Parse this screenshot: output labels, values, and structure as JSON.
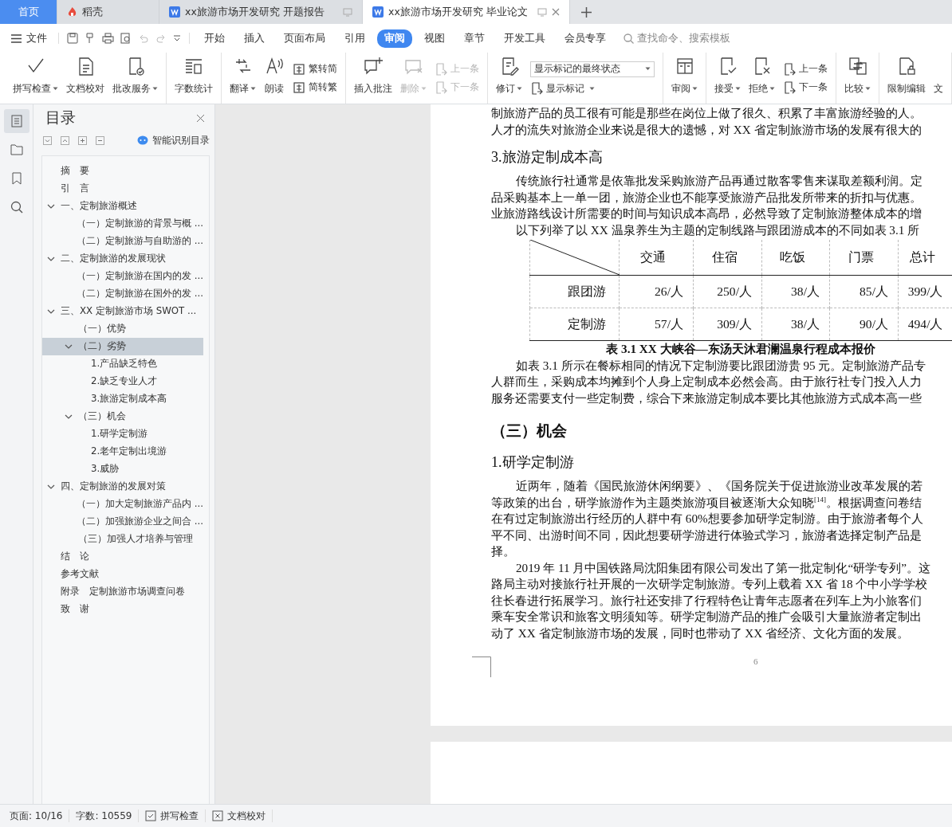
{
  "tabs": [
    {
      "label": "首页",
      "kind": "home",
      "selected": false
    },
    {
      "label": "稻壳",
      "kind": "app",
      "selected": false
    },
    {
      "label": "xx旅游市场开发研究 开题报告",
      "kind": "doc",
      "selected": false
    },
    {
      "label": "xx旅游市场开发研究 毕业论文",
      "kind": "doc",
      "selected": true
    }
  ],
  "menu": {
    "file": "文件",
    "tabs": [
      {
        "label": "开始",
        "selected": false
      },
      {
        "label": "插入",
        "selected": false
      },
      {
        "label": "页面布局",
        "selected": false
      },
      {
        "label": "引用",
        "selected": false
      },
      {
        "label": "审阅",
        "selected": true
      },
      {
        "label": "视图",
        "selected": false
      },
      {
        "label": "章节",
        "selected": false
      },
      {
        "label": "开发工具",
        "selected": false
      },
      {
        "label": "会员专享",
        "selected": false
      }
    ],
    "search": {
      "placeholder": "查找命令、搜索模板"
    }
  },
  "ribbon_groups": [
    {
      "tools": [
        {
          "kind": "large",
          "label": "拼写检查",
          "dropdown": true,
          "disabled": false
        },
        {
          "kind": "large",
          "label": "文档校对",
          "dropdown": false,
          "disabled": false
        },
        {
          "kind": "large",
          "label": "批改服务",
          "dropdown": true,
          "disabled": false
        }
      ]
    },
    {
      "tools": [
        {
          "kind": "large",
          "label": "字数统计",
          "dropdown": false,
          "disabled": false
        }
      ]
    },
    {
      "tools": [
        {
          "kind": "large",
          "label": "翻译",
          "dropdown": true,
          "disabled": false
        },
        {
          "kind": "large",
          "label": "朗读",
          "dropdown": false,
          "disabled": false
        },
        {
          "kind": "stack",
          "items": [
            {
              "label": "繁转简",
              "dropdown": false,
              "disabled": false
            },
            {
              "label": "简转繁",
              "dropdown": false,
              "disabled": false
            }
          ]
        }
      ]
    },
    {
      "tools": [
        {
          "kind": "large",
          "label": "插入批注",
          "dropdown": false,
          "disabled": false
        },
        {
          "kind": "large",
          "label": "删除",
          "dropdown": true,
          "disabled": true
        },
        {
          "kind": "stack",
          "items": [
            {
              "label": "上一条",
              "dropdown": false,
              "disabled": true
            },
            {
              "label": "下一条",
              "dropdown": false,
              "disabled": true
            }
          ]
        }
      ]
    },
    {
      "tools": [
        {
          "kind": "large",
          "label": "修订",
          "dropdown": true,
          "disabled": false
        },
        {
          "kind": "combo",
          "value": "显示标记的最终状态",
          "items": [
            {
              "label": "显示标记",
              "dropdown": true,
              "disabled": false
            }
          ]
        }
      ]
    },
    {
      "tools": [
        {
          "kind": "large",
          "label": "审阅",
          "dropdown": true,
          "disabled": false
        }
      ]
    },
    {
      "tools": [
        {
          "kind": "large",
          "label": "接受",
          "dropdown": true,
          "disabled": false
        },
        {
          "kind": "large",
          "label": "拒绝",
          "dropdown": true,
          "disabled": false
        },
        {
          "kind": "stack",
          "items": [
            {
              "label": "上一条",
              "dropdown": false,
              "disabled": false
            },
            {
              "label": "下一条",
              "dropdown": false,
              "disabled": false
            }
          ]
        }
      ]
    },
    {
      "tools": [
        {
          "kind": "large",
          "label": "比较",
          "dropdown": true,
          "disabled": false
        }
      ]
    },
    {
      "tools": [
        {
          "kind": "large",
          "label": "限制编辑",
          "dropdown": false,
          "disabled": false
        },
        {
          "kind": "large",
          "label": "文",
          "dropdown": false,
          "disabled": false
        }
      ]
    }
  ],
  "rail": [
    {
      "selected": true
    },
    {
      "selected": false
    },
    {
      "selected": false
    },
    {
      "selected": false
    }
  ],
  "nav": {
    "title": "目录",
    "smart_button": "智能识别目录",
    "items": [
      {
        "label": "摘　要",
        "selected": false
      },
      {
        "label": "引　言",
        "selected": false
      },
      {
        "label": "一、定制旅游概述",
        "selected": false,
        "expanded": true,
        "children": [
          {
            "label": "（一）定制旅游的背景与概 ...",
            "selected": false
          },
          {
            "label": "（二）定制旅游与自助游的 ...",
            "selected": false
          }
        ]
      },
      {
        "label": "二、定制旅游的发展现状",
        "selected": false,
        "expanded": true,
        "children": [
          {
            "label": "（一）定制旅游在国内的发 ...",
            "selected": false
          },
          {
            "label": "（二）定制旅游在国外的发 ...",
            "selected": false
          }
        ]
      },
      {
        "label": "三、XX 定制旅游市场 SWOT  ...",
        "selected": false,
        "expanded": true,
        "children": [
          {
            "label": "（一）优势",
            "selected": false
          },
          {
            "label": "（二）劣势",
            "selected": true,
            "expanded": true,
            "children": [
              {
                "label": "1.产品缺乏特色",
                "selected": false
              },
              {
                "label": "2.缺乏专业人才",
                "selected": false
              },
              {
                "label": "3.旅游定制成本高",
                "selected": false
              }
            ]
          },
          {
            "label": "（三）机会",
            "selected": false,
            "expanded": true,
            "children": [
              {
                "label": "1.研学定制游",
                "selected": false
              },
              {
                "label": "2.老年定制出境游",
                "selected": false
              },
              {
                "label": "3.威胁",
                "selected": false
              }
            ]
          }
        ]
      },
      {
        "label": "四、定制旅游的发展对策",
        "selected": false,
        "expanded": true,
        "children": [
          {
            "label": "（一）加大定制旅游产品内 ...",
            "selected": false
          },
          {
            "label": "（二）加强旅游企业之间合 ...",
            "selected": false
          },
          {
            "label": "（三）加强人才培养与管理",
            "selected": false
          }
        ]
      },
      {
        "label": "结　论",
        "selected": false
      },
      {
        "label": "参考文献",
        "selected": false
      },
      {
        "label": "附录　定制旅游市场调查问卷",
        "selected": false
      },
      {
        "label": "致　谢",
        "selected": false
      }
    ]
  },
  "document": {
    "blocks": [
      {
        "kind": "para",
        "indent": false,
        "lines": [
          "制旅游产品的员工很有可能是那些在岗位上做了很久、积累了丰富旅游经验的人。",
          "人才的流失对旅游企业来说是很大的遗憾，对 XX 省定制旅游市场的发展有很大的"
        ]
      },
      {
        "kind": "h3",
        "text": "3.旅游定制成本高"
      },
      {
        "kind": "para",
        "indent": true,
        "lines": [
          "传统旅行社通常是依靠批发采购旅游产品再通过散客零售来谋取差额利润。定",
          "品采购基本上一单一团，旅游企业也不能享受旅游产品批发所带来的折扣与优惠。",
          "业旅游路线设计所需要的时间与知识成本高昂，必然导致了定制旅游整体成本的增"
        ]
      },
      {
        "kind": "para",
        "indent": true,
        "lines": [
          "以下列举了以 XX 温泉养生为主题的定制线路与跟团游成本的不同如表 3.1 所"
        ]
      },
      {
        "kind": "table",
        "columns": [
          "交通",
          "住宿",
          "吃饭",
          "门票",
          "总计"
        ],
        "rows": [
          {
            "label": "跟团游",
            "cells": [
              "26/人",
              "250/人",
              "38/人",
              "85/人",
              "399/人"
            ]
          },
          {
            "label": "定制游",
            "cells": [
              "57/人",
              "309/人",
              "38/人",
              "90/人",
              "494/人"
            ]
          }
        ]
      },
      {
        "kind": "caption",
        "text": "表 3.1 XX 大峡谷—东汤天沐君澜温泉行程成本报价"
      },
      {
        "kind": "para",
        "indent": true,
        "lines": [
          "如表 3.1 所示在餐标相同的情况下定制游要比跟团游贵 95 元。定制旅游产品专",
          "人群而生，采购成本均摊到个人身上定制成本必然会高。由于旅行社专门投入人力",
          "服务还需要支付一些定制费，综合下来旅游定制成本要比其他旅游方式成本高一些"
        ]
      },
      {
        "kind": "h2",
        "text": "（三）机会"
      },
      {
        "kind": "h3",
        "text": "1.研学定制游"
      },
      {
        "kind": "para",
        "indent": true,
        "lines": [
          "近两年，随着《国民旅游休闲纲要》、《国务院关于促进旅游业改革发展的若",
          "等政策的出台，研学旅游作为主题类旅游项目被逐渐大众知晓$^{[14]}$。根据调查问卷结",
          "在有过定制旅游出行经历的人群中有 60%想要参加研学定制游。由于旅游者每个人",
          "平不同、出游时间不同，因此想要研学游进行体验式学习，旅游者选择定制产品是",
          "择。"
        ]
      },
      {
        "kind": "para",
        "indent": true,
        "lines": [
          "2019 年 11 月中国铁路局沈阳集团有限公司发出了第一批定制化“研学专列”。这",
          "路局主动对接旅行社开展的一次研学定制旅游。专列上载着 XX 省 18 个中小学学校",
          "往长春进行拓展学习。旅行社还安排了行程特色让青年志愿者在列车上为小旅客们",
          "乘车安全常识和旅客文明须知等。研学定制游产品的推广会吸引大量旅游者定制出",
          "动了 XX 省定制旅游市场的发展，同时也带动了 XX 省经济、文化方面的发展。"
        ]
      }
    ],
    "page_number": "6"
  },
  "status_bar": {
    "page": "页面: 10/16",
    "words": "字数: 10559",
    "spell": "拼写检查",
    "proof": "文档校对"
  }
}
